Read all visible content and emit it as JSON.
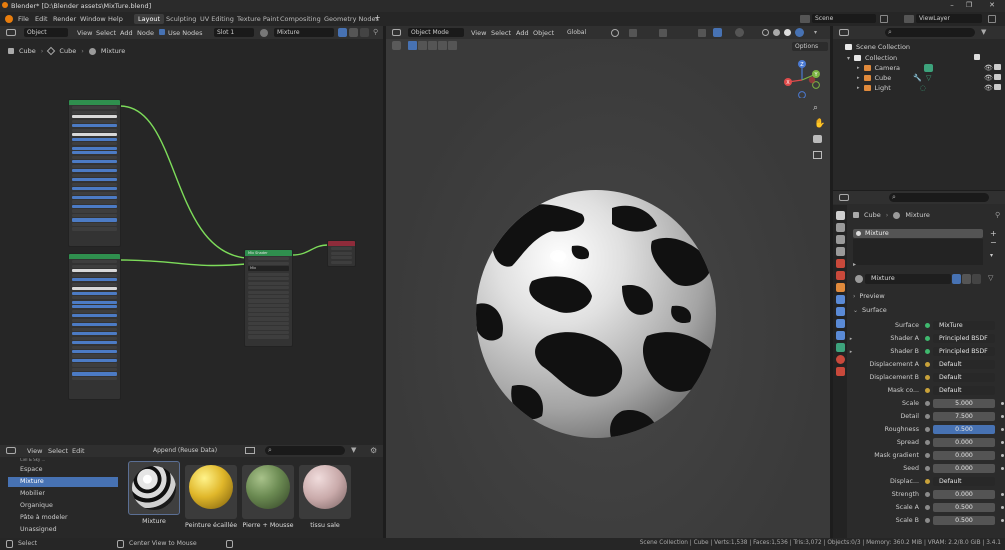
{
  "window": {
    "title": "Blender* [D:\\Blender assets\\MixTure.blend]"
  },
  "menu": [
    "File",
    "Edit",
    "Render",
    "Window",
    "Help"
  ],
  "workspaces": [
    "Layout",
    "Sculpting",
    "UV Editing",
    "Texture Paint",
    "Compositing",
    "Geometry Nodes"
  ],
  "active_workspace": "Layout",
  "scene": {
    "scene_label": "Scene",
    "view_layer": "ViewLayer"
  },
  "node_editor": {
    "mode": "Object",
    "menus": [
      "View",
      "Select",
      "Add",
      "Node"
    ],
    "use_nodes_label": "Use Nodes",
    "slot": "Slot 1",
    "material": "Mixture",
    "breadcrumb": [
      "Cube",
      "Cube",
      "Mixture"
    ],
    "mix_node_title": "Mix Shader",
    "mix_node_field": "Mix"
  },
  "asset_browser": {
    "menus": [
      "View",
      "Select",
      "Edit"
    ],
    "import_mode": "Append (Reuse Data)",
    "categories": [
      "Espace",
      "Mixture",
      "Mobilier",
      "Organique",
      "Pâte à modeler",
      "Unassigned"
    ],
    "selected_category": "Mixture",
    "cut_category": "Ciel & Sky ...",
    "assets": [
      "Mixture",
      "Peinture écaillée",
      "Pierre + Mousse",
      "tissu sale"
    ]
  },
  "viewport": {
    "mode": "Object Mode",
    "menus": [
      "View",
      "Select",
      "Add",
      "Object"
    ],
    "transform": "Global",
    "options_label": "Options",
    "gizmo": {
      "z": "Z",
      "y": "Y",
      "x": "X"
    }
  },
  "outliner": {
    "root": "Scene Collection",
    "collection": "Collection",
    "items": [
      "Camera",
      "Cube",
      "Light"
    ]
  },
  "properties": {
    "breadcrumb_object": "Cube",
    "breadcrumb_material": "Mixture",
    "slot_material": "Mixture",
    "material_name": "Mixture",
    "panels": {
      "preview": "Preview",
      "surface": "Surface"
    },
    "rows": [
      {
        "label": "Surface",
        "value": "MixTure",
        "kind": "dark",
        "dot": "#3fb96e"
      },
      {
        "label": "Shader A",
        "value": "Principled BSDF",
        "kind": "dark",
        "dot": "#3fb96e",
        "expand": true
      },
      {
        "label": "Shader B",
        "value": "Principled BSDF",
        "kind": "dark",
        "dot": "#3fb96e",
        "expand": true
      },
      {
        "label": "Displacement A",
        "value": "Default",
        "kind": "dark",
        "dot": "#c9a23a"
      },
      {
        "label": "Displacement B",
        "value": "Default",
        "kind": "dark",
        "dot": "#c9a23a"
      },
      {
        "label": "Mask co...",
        "value": "Default",
        "kind": "dark",
        "dot": "#c9a23a"
      },
      {
        "label": "Scale",
        "value": "5.000",
        "kind": "num",
        "dot": "#8b8b8b"
      },
      {
        "label": "Detail",
        "value": "7.500",
        "kind": "num",
        "dot": "#8b8b8b"
      },
      {
        "label": "Roughness",
        "value": "0.500",
        "kind": "blue",
        "dot": "#8b8b8b"
      },
      {
        "label": "Spread",
        "value": "0.000",
        "kind": "num",
        "dot": "#8b8b8b"
      },
      {
        "label": "Mask gradient",
        "value": "0.000",
        "kind": "num",
        "dot": "#8b8b8b"
      },
      {
        "label": "Seed",
        "value": "0.000",
        "kind": "num",
        "dot": "#8b8b8b"
      },
      {
        "label": "Displac...",
        "value": "Default",
        "kind": "dark",
        "dot": "#c9a23a"
      },
      {
        "label": "Strength",
        "value": "0.000",
        "kind": "num",
        "dot": "#8b8b8b"
      },
      {
        "label": "Scale A",
        "value": "0.500",
        "kind": "num",
        "dot": "#8b8b8b"
      },
      {
        "label": "Scale B",
        "value": "0.500",
        "kind": "num",
        "dot": "#8b8b8b"
      }
    ]
  },
  "statusbar": {
    "left": "Select",
    "middle": "Center View to Mouse",
    "right": "Scene Collection | Cube | Verts:1,538 | Faces:1,536 | Tris:3,072 | Objects:0/3 | Memory: 360.2 MiB | VRAM: 2.2/8.0 GiB | 3.4.1"
  },
  "colors": {
    "accent": "#4772b3",
    "shader_socket": "#3fb96e",
    "vector_socket": "#c9a23a",
    "node_link": "#7ddc5a"
  }
}
